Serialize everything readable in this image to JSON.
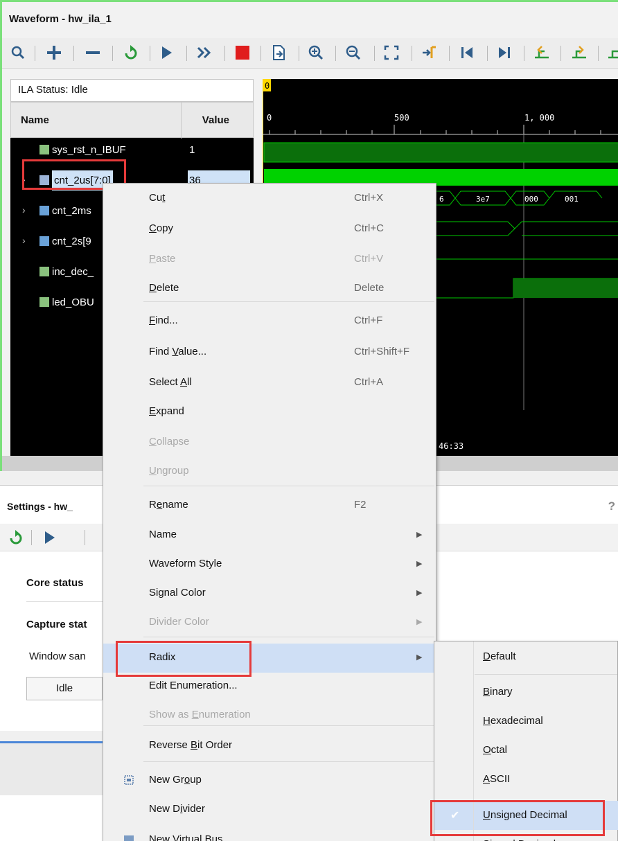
{
  "waveform": {
    "title": "Waveform - hw_ila_1",
    "ila_status": "ILA Status: Idle",
    "marker": "0",
    "columns": {
      "name": "Name",
      "value": "Value"
    },
    "ticks": [
      "0",
      "500",
      "1, 000"
    ],
    "signals": [
      {
        "name": "sys_rst_n_IBUF",
        "value": "1",
        "expandable": false
      },
      {
        "name": "cnt_2us[7:0]",
        "value": "36",
        "expandable": true
      },
      {
        "name": "cnt_2ms",
        "value": "",
        "expandable": true
      },
      {
        "name": "cnt_2s[9",
        "value": "",
        "expandable": true
      },
      {
        "name": "inc_dec_",
        "value": "",
        "expandable": false
      },
      {
        "name": "led_OBU",
        "value": "",
        "expandable": false
      }
    ],
    "bus_values": [
      "6",
      "3e7",
      "000",
      "001"
    ],
    "time_readout": "46:33"
  },
  "settings": {
    "title": "Settings - hw_",
    "help": "?",
    "core_status": "Core status",
    "capture_status": "Capture stat",
    "window_samples": "Window san",
    "idle_button": "Idle"
  },
  "context_menu": {
    "items": [
      {
        "label": "Cut",
        "shortcut": "Ctrl+X"
      },
      {
        "label": "Copy",
        "shortcut": "Ctrl+C"
      },
      {
        "label": "Paste",
        "shortcut": "Ctrl+V"
      },
      {
        "label": "Delete",
        "shortcut": "Delete"
      },
      {
        "label": "Find...",
        "shortcut": "Ctrl+F"
      },
      {
        "label": "Find Value...",
        "shortcut": "Ctrl+Shift+F"
      },
      {
        "label": "Select All",
        "shortcut": "Ctrl+A"
      },
      {
        "label": "Expand"
      },
      {
        "label": "Collapse"
      },
      {
        "label": "Ungroup"
      },
      {
        "label": "Rename",
        "shortcut": "F2"
      },
      {
        "label": "Name"
      },
      {
        "label": "Waveform Style"
      },
      {
        "label": "Signal Color"
      },
      {
        "label": "Divider Color"
      },
      {
        "label": "Radix"
      },
      {
        "label": "Edit Enumeration..."
      },
      {
        "label": "Show as Enumeration"
      },
      {
        "label": "Reverse Bit Order"
      },
      {
        "label": "New Group"
      },
      {
        "label": "New Divider"
      },
      {
        "label": "New Virtual Bus"
      }
    ]
  },
  "radix_submenu": {
    "items": [
      "Default",
      "Binary",
      "Hexadecimal",
      "Octal",
      "ASCII",
      "Unsigned Decimal",
      "Signed Decimal"
    ],
    "selected": "Unsigned Decimal"
  },
  "colors": {
    "accent_green": "#7be07b",
    "wave_green": "#00c800",
    "highlight_red": "#e53a3a",
    "menu_highlight": "#cfdff5"
  }
}
